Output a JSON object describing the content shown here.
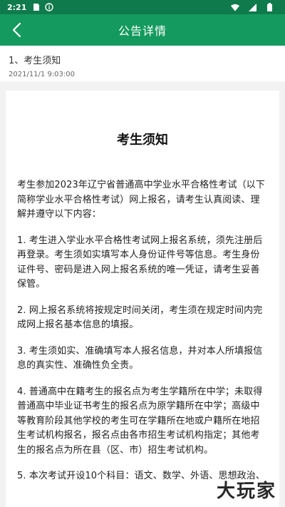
{
  "status_bar": {
    "time": "2:21"
  },
  "nav": {
    "title": "公告详情"
  },
  "notice": {
    "title": "1、考生须知",
    "date": "2021/11/1 9:03:00"
  },
  "article": {
    "heading": "考生须知",
    "paragraphs": [
      "考生参加2023年辽宁省普通高中学业水平合格性考试（以下简称学业水平合格性考试）网上报名，请考生认真阅读、理解并遵守以下内容：",
      "1. 考生进入学业水平合格性考试网上报名系统，须先注册后再登录。考生须如实填写本人身份证件号等信息。考生身份证件号、密码是进入网上报名系统的唯一凭证，请考生妥善保管。",
      "2. 网上报名系统将按规定时间关闭，考生须在规定时间内完成网上报名基本信息的填报。",
      "3. 考生须如实、准确填写本人报名信息，并对本人所填报信息的真实性、准确性负全责。",
      "4. 普通高中在籍考生的报名点为考生学籍所在中学；未取得普通高中毕业证书考生的报名点为原学籍所在中学；高级中等教育阶段其他学校的考生可在学籍所在地或户籍所在地招生考试机构报名，报名点由各市招生考试机构指定；其他考生的报名点为所在县（区、市）招生考试机构。",
      "5. 本次考试开设10个科目：语文、数学、外语、思想政治、"
    ]
  },
  "watermark": "大玩家",
  "colors": {
    "status_bar": "#0f7a4c",
    "nav_bar": "#149a5e"
  }
}
